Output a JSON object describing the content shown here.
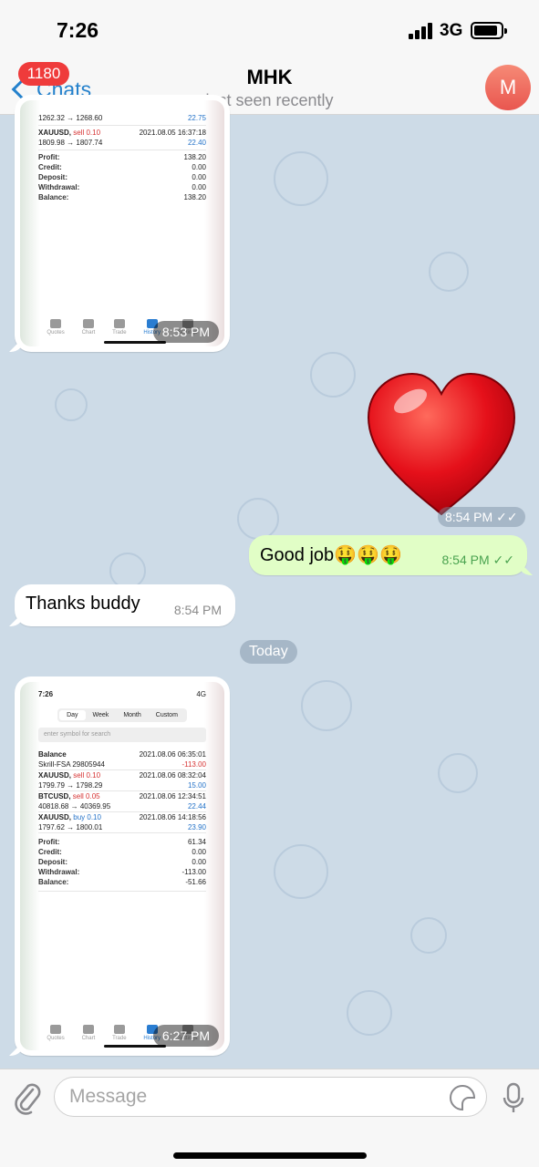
{
  "status": {
    "time": "7:26",
    "network": "3G"
  },
  "nav": {
    "back_label": "Chats",
    "badge": "1180",
    "title": "MHK",
    "subtitle": "last seen recently",
    "avatar_letter": "M"
  },
  "messages": {
    "img1": {
      "time": "8:53 PM",
      "trades": [
        {
          "prices": "1262.32 → 1268.60",
          "date": "",
          "profit": "22.75"
        },
        {
          "symbol": "XAUUSD,",
          "side": "sell 0.10",
          "date": "2021.08.05 16:37:18",
          "prices": "1809.98 → 1807.74",
          "profit": "22.40"
        }
      ],
      "summary": [
        {
          "label": "Profit:",
          "value": "138.20"
        },
        {
          "label": "Credit:",
          "value": "0.00"
        },
        {
          "label": "Deposit:",
          "value": "0.00"
        },
        {
          "label": "Withdrawal:",
          "value": "0.00"
        },
        {
          "label": "Balance:",
          "value": "138.20"
        }
      ],
      "tabs": [
        "Quotes",
        "Chart",
        "Trade",
        "History",
        "Settings"
      ]
    },
    "heart_time": "8:54 PM",
    "out_text": "Good job🤑🤑🤑",
    "out_time": "8:54 PM",
    "in_text": "Thanks buddy",
    "in_time": "8:54 PM",
    "date_divider": "Today",
    "img2": {
      "time": "6:27 PM",
      "phone_time": "7:26",
      "phone_net": "4G",
      "periods": [
        "Day",
        "Week",
        "Month",
        "Custom"
      ],
      "search_placeholder": "enter symbol for search",
      "rows": [
        {
          "symbol": "Balance",
          "side": "",
          "date": "2021.08.06 06:35:01",
          "sub": "Skrill-FSA 29805944",
          "profit": "-113.00"
        },
        {
          "symbol": "XAUUSD,",
          "side": "sell 0.10",
          "date": "2021.08.06 08:32:04",
          "sub": "1799.79 → 1798.29",
          "profit": "15.00"
        },
        {
          "symbol": "BTCUSD,",
          "side": "sell 0.05",
          "date": "2021.08.06 12:34:51",
          "sub": "40818.68 → 40369.95",
          "profit": "22.44"
        },
        {
          "symbol": "XAUUSD,",
          "side": "buy 0.10",
          "date": "2021.08.06 14:18:56",
          "sub": "1797.62 → 1800.01",
          "profit": "23.90"
        }
      ],
      "summary": [
        {
          "label": "Profit:",
          "value": "61.34"
        },
        {
          "label": "Credit:",
          "value": "0.00"
        },
        {
          "label": "Deposit:",
          "value": "0.00"
        },
        {
          "label": "Withdrawal:",
          "value": "-113.00"
        },
        {
          "label": "Balance:",
          "value": "-51.66"
        }
      ],
      "tabs": [
        "Quotes",
        "Chart",
        "Trade",
        "History",
        "Settings"
      ]
    }
  },
  "input": {
    "placeholder": "Message"
  }
}
